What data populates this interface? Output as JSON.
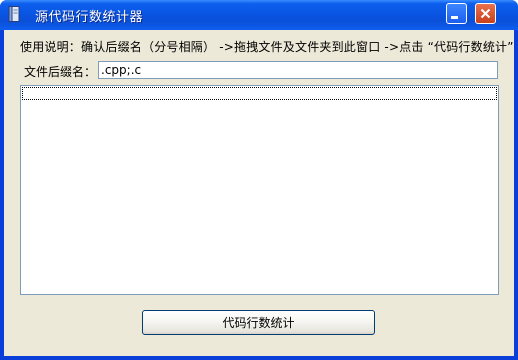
{
  "window": {
    "title": "源代码行数统计器",
    "icon": "book-icon"
  },
  "titlebar": {
    "minimize_icon": "minimize-icon",
    "close_icon": "close-icon"
  },
  "instructions": "使用说明：确认后缀名（分号相隔） ->拖拽文件及文件夹到此窗口 ->点击 “代码行数统计”",
  "suffix": {
    "label": "文件后缀名：",
    "value": ".cpp;.c"
  },
  "file_list": {
    "items": []
  },
  "actions": {
    "count_button_label": "代码行数统计"
  },
  "colors": {
    "titlebar": "#0a55e3",
    "client_background": "#ece9d8",
    "input_border": "#7f9db9",
    "close_button": "#d95a35"
  }
}
